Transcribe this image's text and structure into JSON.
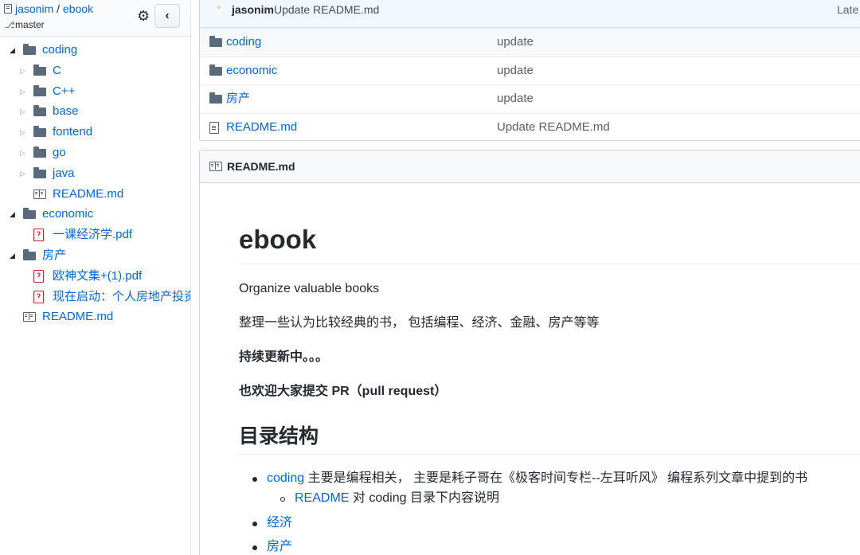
{
  "sidebar": {
    "owner": "jasonim",
    "separator": "/",
    "repo": "ebook",
    "branch": "master",
    "settings_icon": "gear-icon",
    "collapse_label": "‹",
    "tree": [
      {
        "label": "coding",
        "type": "folder",
        "expanded": true,
        "depth": 0
      },
      {
        "label": "C",
        "type": "folder",
        "expanded": false,
        "depth": 1
      },
      {
        "label": "C++",
        "type": "folder",
        "expanded": false,
        "depth": 1
      },
      {
        "label": "base",
        "type": "folder",
        "expanded": false,
        "depth": 1
      },
      {
        "label": "fontend",
        "type": "folder",
        "expanded": false,
        "depth": 1
      },
      {
        "label": "go",
        "type": "folder",
        "expanded": false,
        "depth": 1
      },
      {
        "label": "java",
        "type": "folder",
        "expanded": false,
        "depth": 1
      },
      {
        "label": "README.md",
        "type": "markdown",
        "depth": 1
      },
      {
        "label": "economic",
        "type": "folder",
        "expanded": true,
        "depth": 0
      },
      {
        "label": "一课经济学.pdf",
        "type": "pdf",
        "depth": 1
      },
      {
        "label": "房产",
        "type": "folder",
        "expanded": true,
        "depth": 0
      },
      {
        "label": "欧神文集+(1).pdf",
        "type": "pdf",
        "depth": 1
      },
      {
        "label": "现在启动：个人房地产投资",
        "type": "pdf",
        "depth": 1
      },
      {
        "label": "README.md",
        "type": "markdown",
        "depth": 0
      }
    ]
  },
  "commit": {
    "author": "jasonim",
    "message": "Update README.md",
    "latest": "Late"
  },
  "files": [
    {
      "name": "coding",
      "message": "update",
      "type": "folder"
    },
    {
      "name": "economic",
      "message": "update",
      "type": "folder"
    },
    {
      "name": "房产",
      "message": "update",
      "type": "folder"
    },
    {
      "name": "README.md",
      "message": "Update README.md",
      "type": "file"
    }
  ],
  "readme": {
    "header": "README.md",
    "title": "ebook",
    "p1": "Organize valuable books",
    "p2": "整理一些认为比较经典的书， 包括编程、经济、金融、房产等等",
    "p3": "持续更新中。。。",
    "p4": "也欢迎大家提交 PR（pull request）",
    "h2": "目录结构",
    "list": {
      "item1_link": "coding",
      "item1_text": " 主要是编程相关， 主要是耗子哥在《极客时间专栏--左耳听风》 编程系列文章中提到的书",
      "sub1_link": "README",
      "sub1_text": " 对 coding 目录下内容说明",
      "item2_link": "经济",
      "item3_link": "房产"
    }
  }
}
